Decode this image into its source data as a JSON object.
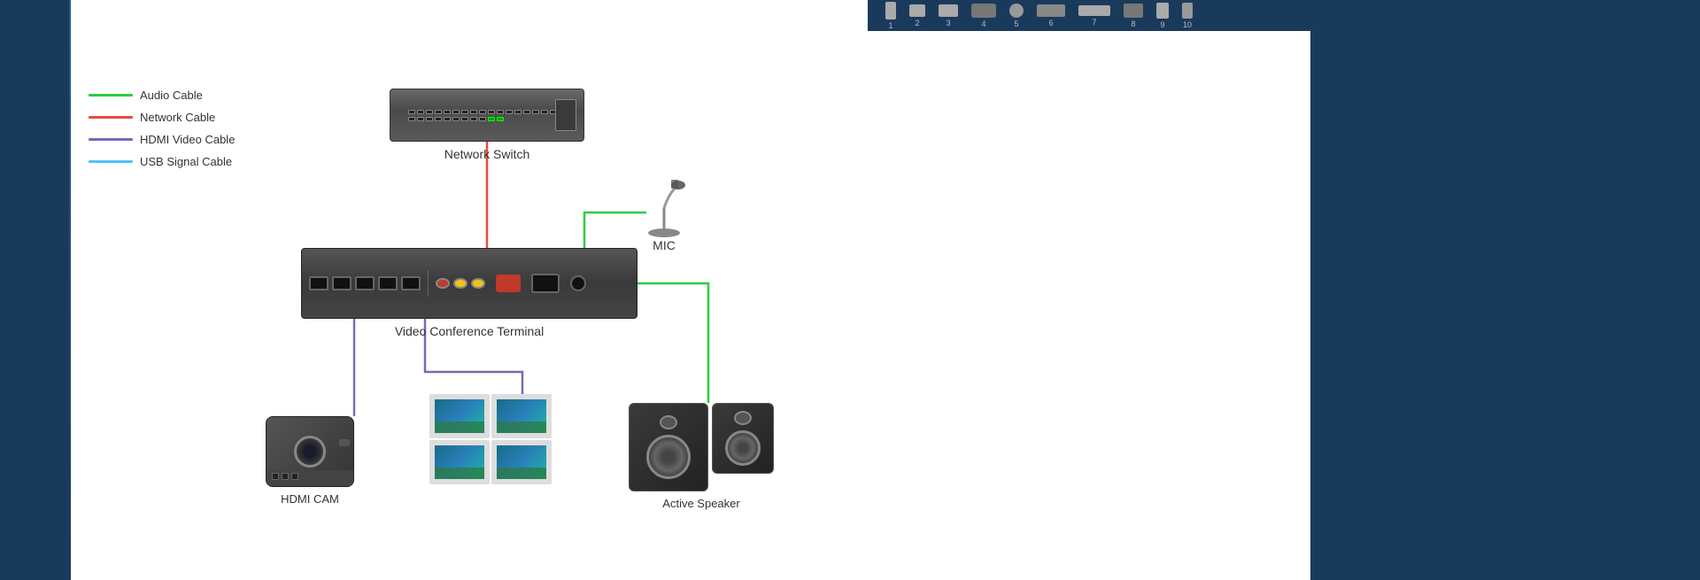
{
  "legend": {
    "items": [
      {
        "id": "audio-cable",
        "label": "Audio Cable",
        "color": "#2ecc40",
        "colorClass": "green-line"
      },
      {
        "id": "network-cable",
        "label": "Network Cable",
        "color": "#e74c3c",
        "colorClass": "red-line"
      },
      {
        "id": "hdmi-video-cable",
        "label": "HDMI Video Cable",
        "color": "#7c6ab5",
        "colorClass": "purple-line"
      },
      {
        "id": "usb-signal-cable",
        "label": "USB Signal Cable",
        "color": "#4fc3f7",
        "colorClass": "blue-line"
      }
    ]
  },
  "devices": {
    "network_switch": {
      "label": "Network Switch"
    },
    "video_conference_terminal": {
      "label": "Video Conference Terminal"
    },
    "mic": {
      "label": "MIC"
    },
    "hdmi_cam": {
      "label": "HDMI CAM"
    },
    "display": {
      "label": ""
    },
    "active_speaker": {
      "label": "Active Speaker"
    }
  },
  "top_bar": {
    "devices": [
      {
        "id": 1,
        "label": "1"
      },
      {
        "id": 2,
        "label": "2"
      },
      {
        "id": 3,
        "label": "3"
      },
      {
        "id": 4,
        "label": "4"
      },
      {
        "id": 5,
        "label": "5"
      },
      {
        "id": 6,
        "label": "6"
      },
      {
        "id": 7,
        "label": "7"
      },
      {
        "id": 8,
        "label": "8"
      },
      {
        "id": 9,
        "label": "9"
      },
      {
        "id": 10,
        "label": "10"
      }
    ]
  },
  "colors": {
    "audio": "#2ecc40",
    "network": "#e74c3c",
    "hdmi": "#7c6ab5",
    "usb": "#4fc3f7",
    "background_main": "#ffffff",
    "background_side": "#1a3a5c"
  }
}
